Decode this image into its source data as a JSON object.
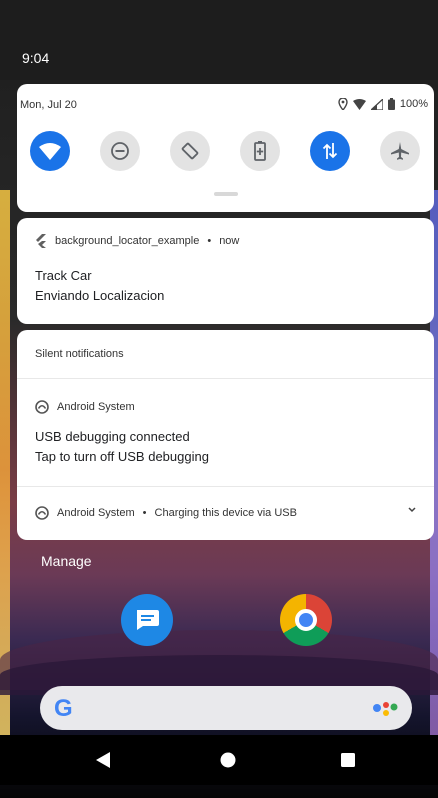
{
  "status_bar": {
    "time": "9:04"
  },
  "quick_settings": {
    "date": "Mon, Jul 20",
    "battery": "100%",
    "tiles": [
      {
        "name": "wifi",
        "state": "on"
      },
      {
        "name": "do-not-disturb",
        "state": "off"
      },
      {
        "name": "auto-rotate",
        "state": "off"
      },
      {
        "name": "battery-saver",
        "state": "off"
      },
      {
        "name": "mobile-data",
        "state": "on"
      },
      {
        "name": "airplane-mode",
        "state": "off"
      }
    ]
  },
  "notification": {
    "app_name": "background_locator_example",
    "time": "now",
    "title": "Track Car",
    "text": "Enviando Localizacion"
  },
  "silent_notifications": {
    "header": "Silent notifications",
    "items": [
      {
        "app": "Android System",
        "title": "USB debugging connected",
        "text": "Tap to turn off USB debugging"
      },
      {
        "app": "Android System",
        "summary": "Charging this device via USB"
      }
    ]
  },
  "manage_label": "Manage",
  "home": {
    "search_logo": "G"
  },
  "colors": {
    "accent": "#1a73e8",
    "card": "#ffffff",
    "statusbar": "#1d1d1d"
  }
}
